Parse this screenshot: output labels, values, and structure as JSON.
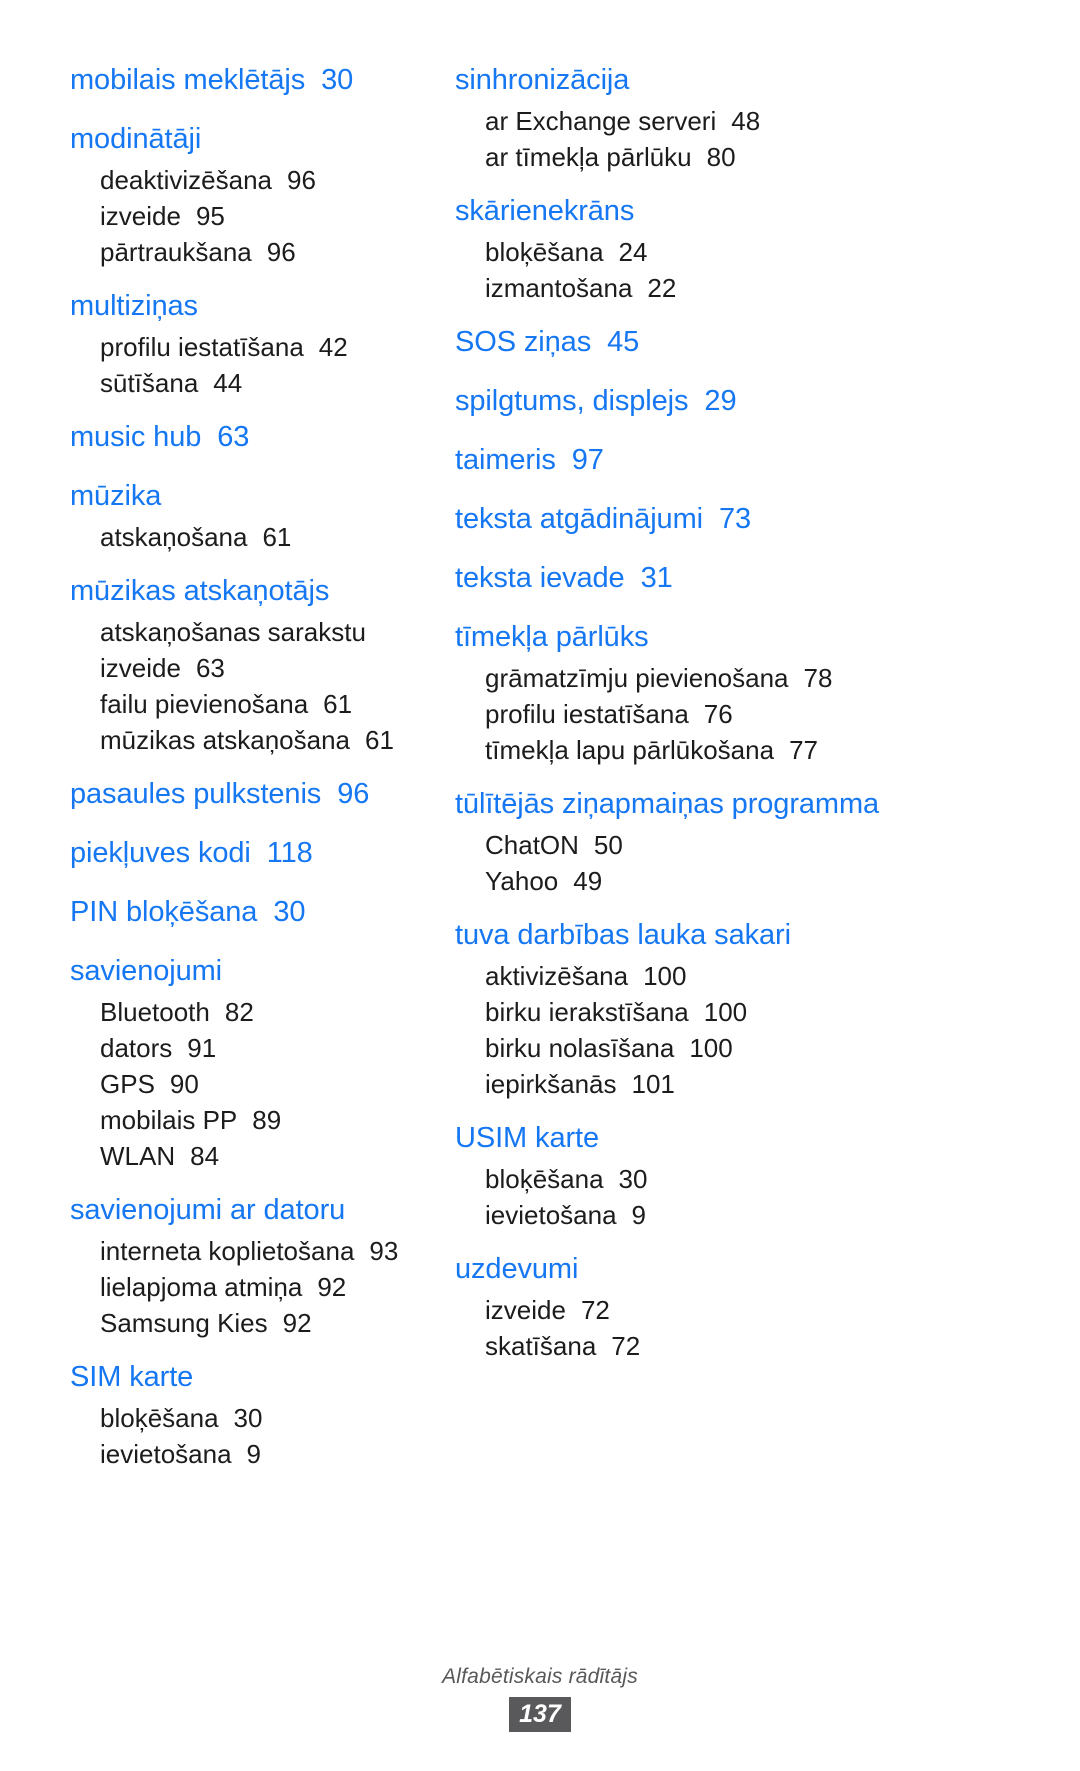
{
  "document": {
    "title": "Alfabētiskais rādītājs",
    "page_number": "137",
    "heading_color": "#1677f2",
    "body_color": "#1c1c1c",
    "footer_color": "#58585a",
    "footer_badge_color": "#59595b"
  },
  "columns": [
    {
      "id": "left",
      "groups": [
        {
          "heading": "mobilais meklētājs",
          "page": "30",
          "subentries": []
        },
        {
          "heading": "modinātāji",
          "page": "",
          "subentries": [
            {
              "label": "deaktivizēšana",
              "page": "96"
            },
            {
              "label": "izveide",
              "page": "95"
            },
            {
              "label": "pārtraukšana",
              "page": "96"
            }
          ]
        },
        {
          "heading": "multiziņas",
          "page": "",
          "subentries": [
            {
              "label": "profilu iestatīšana",
              "page": "42"
            },
            {
              "label": "sūtīšana",
              "page": "44"
            }
          ]
        },
        {
          "heading": "music hub",
          "page": "63",
          "subentries": []
        },
        {
          "heading": "mūzika",
          "page": "",
          "subentries": [
            {
              "label": "atskaņošana",
              "page": "61"
            }
          ]
        },
        {
          "heading": "mūzikas atskaņotājs",
          "page": "",
          "subentries": [
            {
              "label": "atskaņošanas sarakstu izveide",
              "page": "63",
              "wrap": true
            },
            {
              "label": "failu pievienošana",
              "page": "61"
            },
            {
              "label": "mūzikas atskaņošana",
              "page": "61"
            }
          ]
        },
        {
          "heading": "pasaules pulkstenis",
          "page": "96",
          "subentries": []
        },
        {
          "heading": "piekļuves kodi",
          "page": "118",
          "subentries": []
        },
        {
          "heading": "PIN bloķēšana",
          "page": "30",
          "subentries": []
        },
        {
          "heading": "savienojumi",
          "page": "",
          "subentries": [
            {
              "label": "Bluetooth",
              "page": "82"
            },
            {
              "label": "dators",
              "page": "91"
            },
            {
              "label": "GPS",
              "page": "90"
            },
            {
              "label": "mobilais PP",
              "page": "89"
            },
            {
              "label": "WLAN",
              "page": "84"
            }
          ]
        },
        {
          "heading": "savienojumi ar datoru",
          "page": "",
          "subentries": [
            {
              "label": "interneta koplietošana",
              "page": "93"
            },
            {
              "label": "lielapjoma atmiņa",
              "page": "92"
            },
            {
              "label": "Samsung Kies",
              "page": "92"
            }
          ]
        },
        {
          "heading": "SIM karte",
          "page": "",
          "subentries": [
            {
              "label": "bloķēšana",
              "page": "30"
            },
            {
              "label": "ievietošana",
              "page": "9"
            }
          ]
        }
      ]
    },
    {
      "id": "right",
      "groups": [
        {
          "heading": "sinhronizācija",
          "page": "",
          "subentries": [
            {
              "label": "ar Exchange serveri",
              "page": "48"
            },
            {
              "label": "ar tīmekļa pārlūku",
              "page": "80"
            }
          ]
        },
        {
          "heading": "skārienekrāns",
          "page": "",
          "subentries": [
            {
              "label": "bloķēšana",
              "page": "24"
            },
            {
              "label": "izmantošana",
              "page": "22"
            }
          ]
        },
        {
          "heading": "SOS ziņas",
          "page": "45",
          "subentries": []
        },
        {
          "heading": "spilgtums, displejs",
          "page": "29",
          "subentries": []
        },
        {
          "heading": "taimeris",
          "page": "97",
          "subentries": []
        },
        {
          "heading": "teksta atgādinājumi",
          "page": "73",
          "subentries": []
        },
        {
          "heading": "teksta ievade",
          "page": "31",
          "subentries": []
        },
        {
          "heading": "tīmekļa pārlūks",
          "page": "",
          "subentries": [
            {
              "label": "grāmatzīmju pievienošana",
              "page": "78",
              "wrap": true
            },
            {
              "label": "profilu iestatīšana",
              "page": "76"
            },
            {
              "label": "tīmekļa lapu pārlūkošana",
              "page": "77",
              "wrap": true
            }
          ]
        },
        {
          "heading": "tūlītējās ziņapmaiņas programma",
          "page": "",
          "wrap": true,
          "subentries": [
            {
              "label": "ChatON",
              "page": "50"
            },
            {
              "label": "Yahoo",
              "page": "49"
            }
          ]
        },
        {
          "heading": "tuva darbības lauka sakari",
          "page": "",
          "subentries": [
            {
              "label": "aktivizēšana",
              "page": "100"
            },
            {
              "label": "birku ierakstīšana",
              "page": "100"
            },
            {
              "label": "birku nolasīšana",
              "page": "100"
            },
            {
              "label": "iepirkšanās",
              "page": "101"
            }
          ]
        },
        {
          "heading": "USIM karte",
          "page": "",
          "subentries": [
            {
              "label": "bloķēšana",
              "page": "30"
            },
            {
              "label": "ievietošana",
              "page": "9"
            }
          ]
        },
        {
          "heading": "uzdevumi",
          "page": "",
          "subentries": [
            {
              "label": "izveide",
              "page": "72"
            },
            {
              "label": "skatīšana",
              "page": "72"
            }
          ]
        }
      ]
    }
  ]
}
